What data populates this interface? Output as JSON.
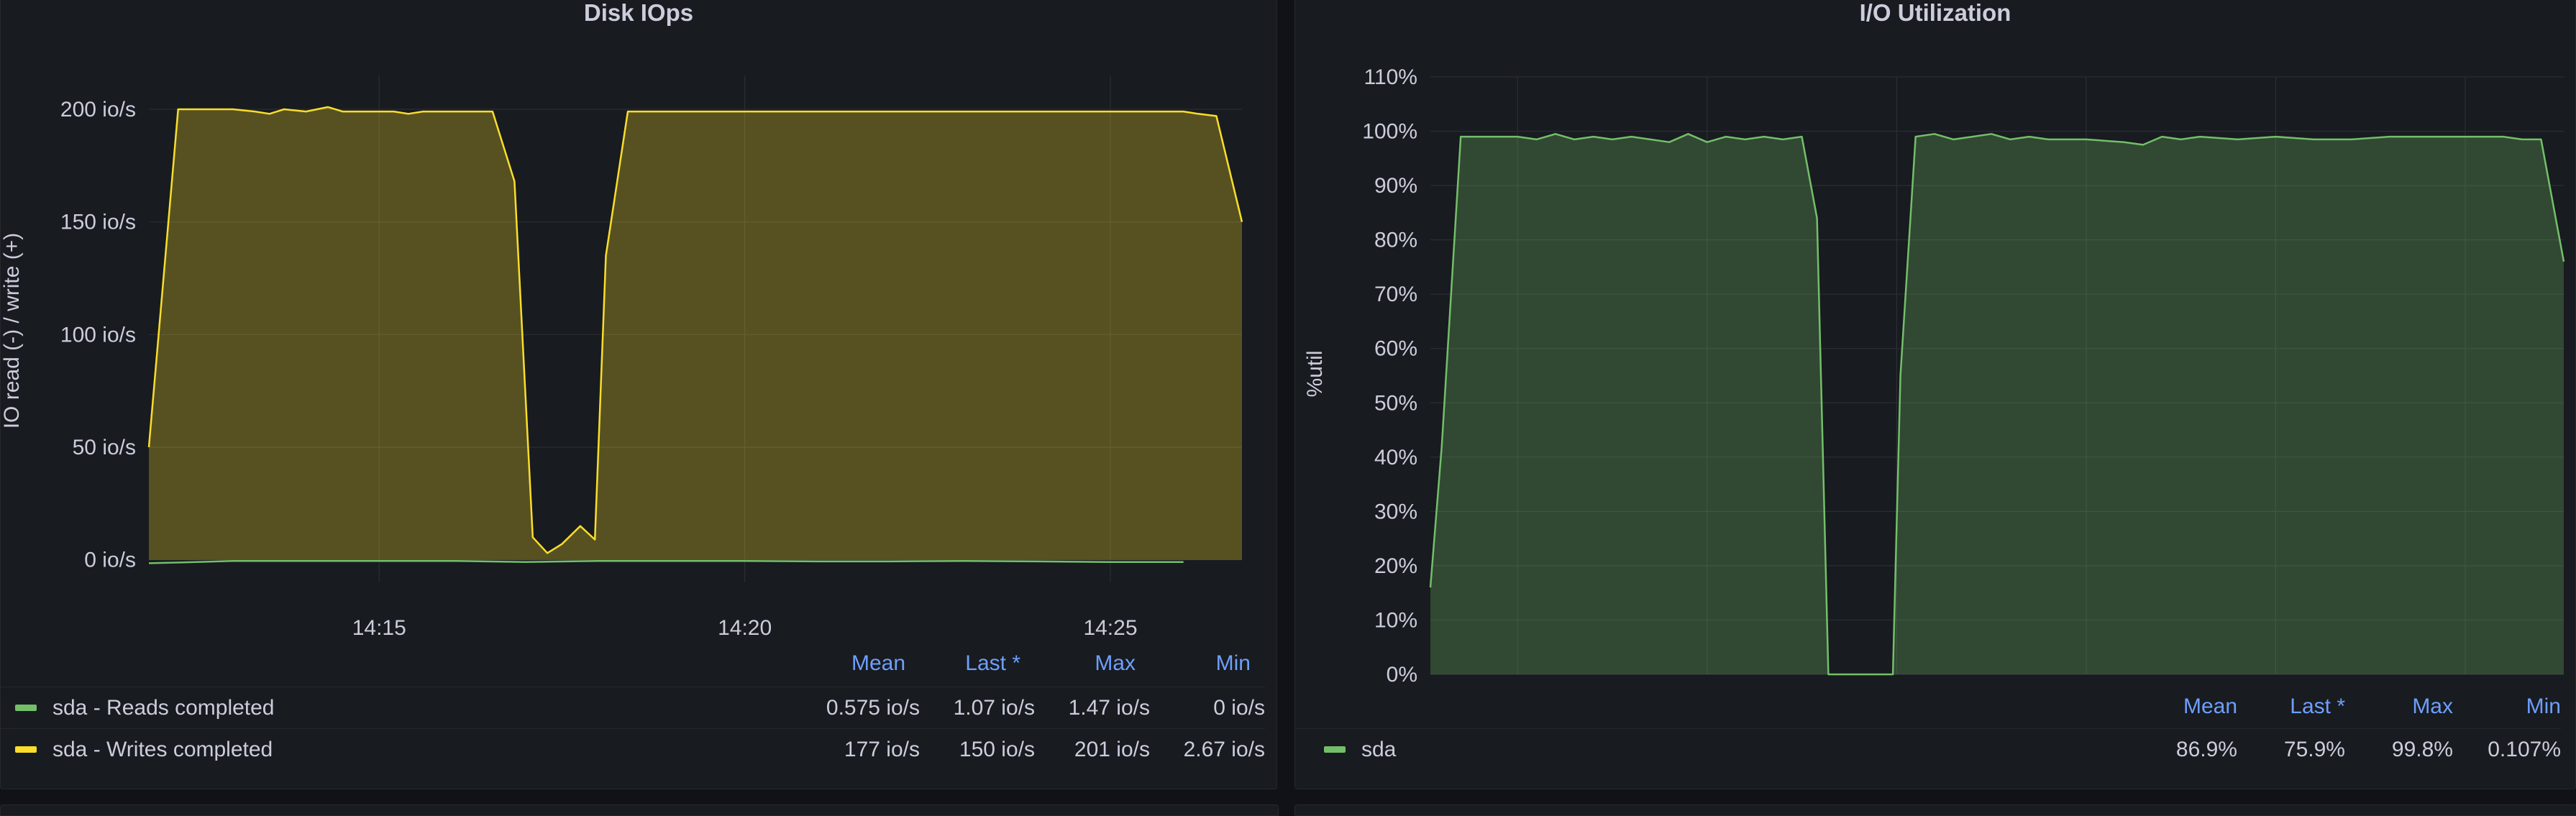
{
  "panels": {
    "disk_iops": {
      "title": "Disk IOps",
      "ylabel": "IO read (-) / write (+)",
      "legend": {
        "headers": [
          "Mean",
          "Last *",
          "Max",
          "Min"
        ],
        "rows": [
          {
            "name": "sda - Reads completed",
            "color": "#73bf69",
            "values": [
              "0.575 io/s",
              "1.07 io/s",
              "1.47 io/s",
              "0 io/s"
            ]
          },
          {
            "name": "sda - Writes completed",
            "color": "#fade2a",
            "values": [
              "177 io/s",
              "150 io/s",
              "201 io/s",
              "2.67 io/s"
            ]
          }
        ]
      }
    },
    "io_util": {
      "title": "I/O Utilization",
      "ylabel": "%util",
      "legend": {
        "headers": [
          "Mean",
          "Last *",
          "Max",
          "Min"
        ],
        "rows": [
          {
            "name": "sda",
            "color": "#73bf69",
            "values": [
              "86.9%",
              "75.9%",
              "99.8%",
              "0.107%"
            ]
          }
        ]
      }
    }
  },
  "chart_data": [
    {
      "type": "area",
      "title": "Disk IOps",
      "ylabel": "IO read (-) / write (+)",
      "xlabel": "",
      "x_ticks": [
        "14:15",
        "14:20",
        "14:25"
      ],
      "x_tick_minutes": [
        15,
        20,
        25
      ],
      "y_ticks": [
        "0 io/s",
        "50 io/s",
        "100 io/s",
        "150 io/s",
        "200 io/s"
      ],
      "y_tick_values": [
        0,
        50,
        100,
        150,
        200
      ],
      "ylim": [
        -10,
        215
      ],
      "xlim_minutes": [
        11.85,
        26.8
      ],
      "grid": true,
      "legend_position": "bottom",
      "series": [
        {
          "name": "sda - Writes completed",
          "color": "#fade2a",
          "fill": true,
          "x_minutes": [
            11.85,
            12.25,
            12.25,
            12.65,
            13.0,
            13.3,
            13.5,
            13.7,
            14.0,
            14.3,
            14.5,
            14.8,
            15.0,
            15.2,
            15.4,
            15.6,
            15.8,
            16.1,
            16.4,
            16.55,
            16.85,
            17.1,
            17.3,
            17.5,
            17.75,
            17.95,
            18.1,
            18.4,
            18.6,
            19.0,
            19.5,
            20.0,
            20.5,
            21.0,
            21.5,
            22.0,
            22.5,
            23.0,
            23.5,
            24.0,
            24.5,
            25.0,
            25.5,
            26.0,
            26.2,
            26.45,
            26.8
          ],
          "y": [
            50,
            200,
            200,
            200,
            200,
            199,
            198,
            200,
            199,
            201,
            199,
            199,
            199,
            199,
            198,
            199,
            199,
            199,
            199,
            199,
            168,
            10,
            3,
            7,
            15,
            9,
            135,
            199,
            199,
            199,
            199,
            199,
            199,
            199,
            199,
            199,
            199,
            199,
            199,
            199,
            199,
            199,
            199,
            199,
            198,
            197,
            150
          ]
        },
        {
          "name": "sda - Reads completed",
          "color": "#73bf69",
          "fill": false,
          "x_minutes": [
            11.85,
            12.5,
            13.0,
            14.0,
            15.0,
            16.0,
            17.0,
            18.0,
            19.0,
            20.0,
            21.0,
            22.0,
            23.0,
            24.0,
            25.0,
            26.0
          ],
          "y": [
            -1.5,
            -1.0,
            -0.5,
            -0.5,
            -0.5,
            -0.5,
            -1.0,
            -0.5,
            -0.5,
            -0.5,
            -0.7,
            -0.7,
            -0.5,
            -0.7,
            -1.0,
            -1.0
          ]
        }
      ]
    },
    {
      "type": "area",
      "title": "I/O Utilization",
      "ylabel": "%util",
      "xlabel": "",
      "y_ticks": [
        "0%",
        "10%",
        "20%",
        "30%",
        "40%",
        "50%",
        "60%",
        "70%",
        "80%",
        "90%",
        "100%",
        "110%"
      ],
      "y_tick_values": [
        0,
        10,
        20,
        30,
        40,
        50,
        60,
        70,
        80,
        90,
        100,
        110
      ],
      "ylim": [
        0,
        110
      ],
      "xlim_minutes": [
        11.85,
        26.8
      ],
      "grid": true,
      "legend_position": "bottom",
      "series": [
        {
          "name": "sda",
          "color": "#73bf69",
          "fill": true,
          "x_minutes": [
            11.85,
            12.0,
            12.25,
            12.5,
            12.75,
            13.0,
            13.25,
            13.5,
            13.75,
            14.0,
            14.25,
            14.5,
            14.75,
            15.0,
            15.25,
            15.5,
            15.75,
            16.0,
            16.25,
            16.5,
            16.75,
            16.95,
            17.1,
            17.4,
            17.75,
            17.95,
            18.05,
            18.25,
            18.5,
            18.75,
            19.0,
            19.25,
            19.5,
            19.75,
            20.0,
            20.5,
            21.0,
            21.25,
            21.5,
            21.75,
            22.0,
            22.5,
            23.0,
            23.5,
            24.0,
            24.5,
            25.0,
            25.5,
            26.0,
            26.25,
            26.5,
            26.8
          ],
          "y": [
            16,
            42,
            99,
            99,
            99,
            99,
            98.5,
            99.5,
            98.5,
            99,
            98.5,
            99,
            98.5,
            98,
            99.5,
            98,
            99,
            98.5,
            99,
            98.5,
            99,
            84,
            0,
            0,
            0,
            0,
            55,
            99,
            99.5,
            98.5,
            99,
            99.5,
            98.5,
            99,
            98.5,
            98.5,
            98,
            97.5,
            99,
            98.5,
            99,
            98.5,
            99,
            98.5,
            98.5,
            99,
            99,
            99,
            99,
            98.5,
            98.5,
            76
          ]
        }
      ]
    }
  ]
}
